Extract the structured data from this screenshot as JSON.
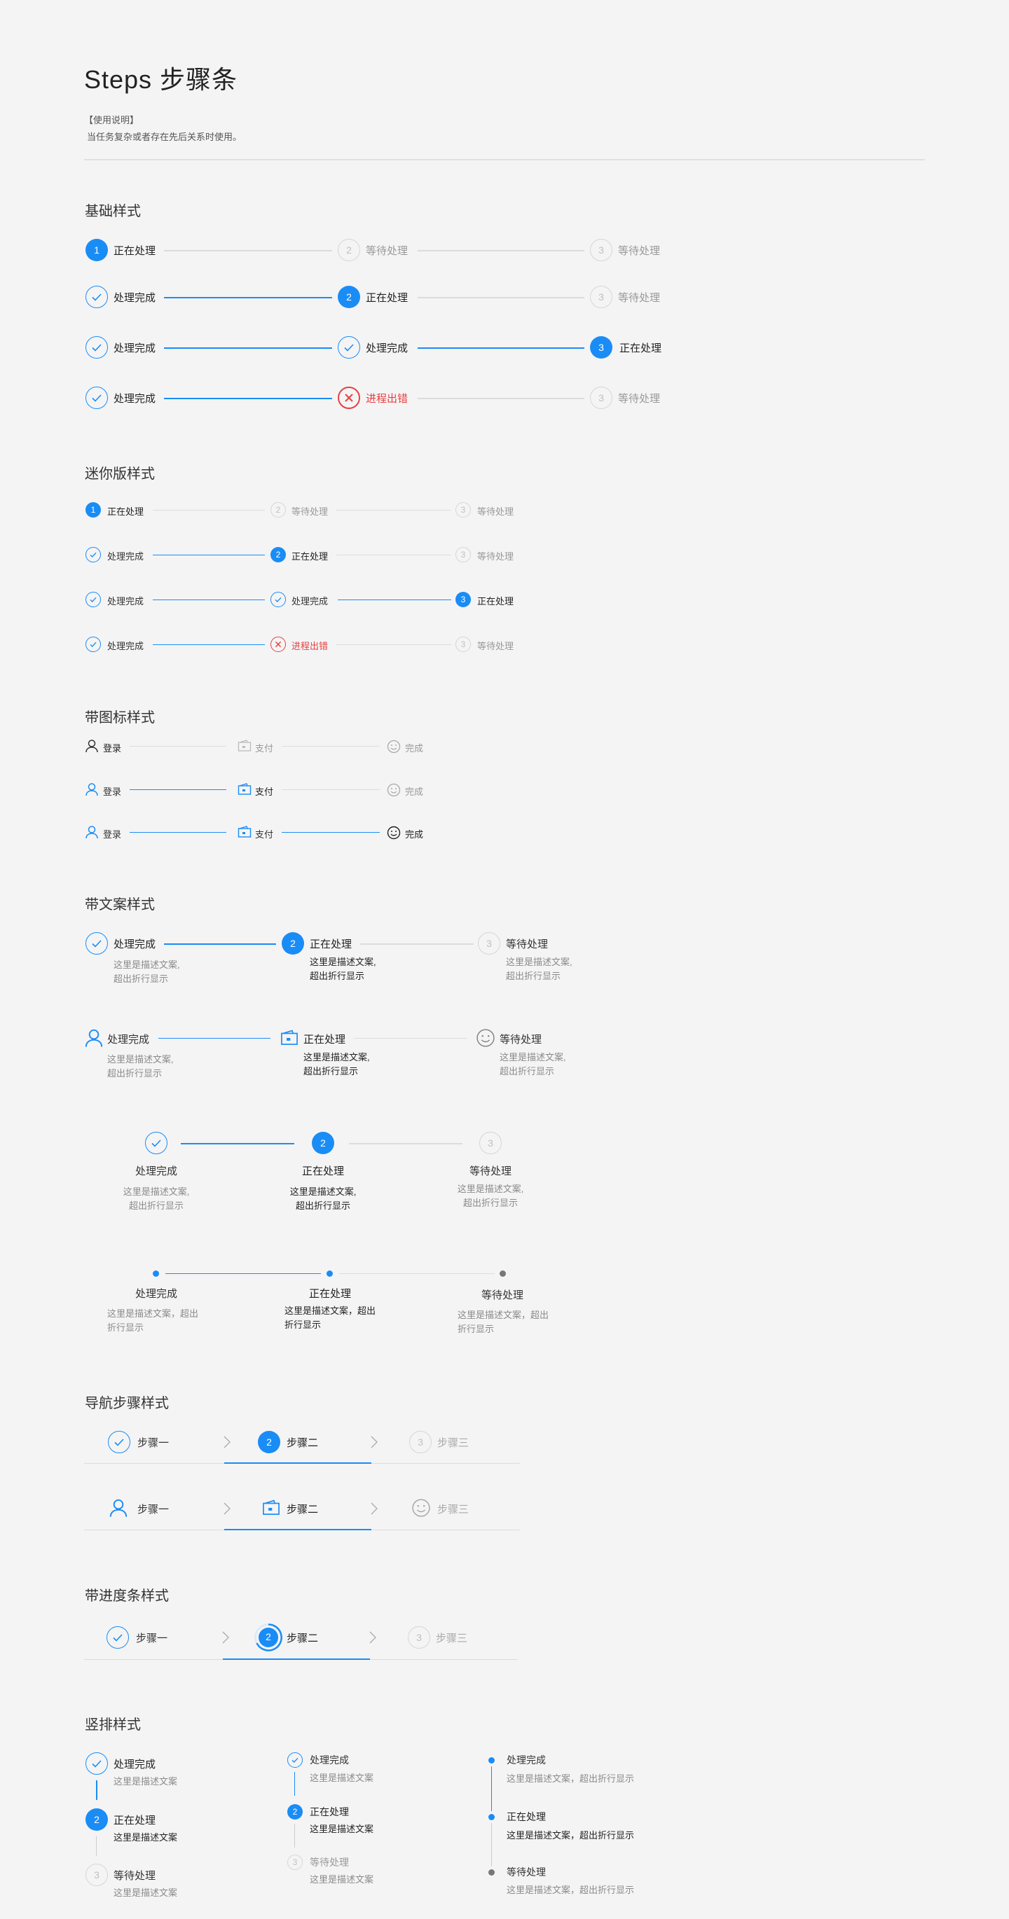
{
  "page": {
    "title": "Steps 步骤条",
    "note_title": "【使用说明】",
    "note_text": "当任务复杂或者存在先后关系时使用。"
  },
  "sections": {
    "basic": "基础样式",
    "mini": "迷你版样式",
    "icon": "带图标样式",
    "desc": "带文案样式",
    "nav": "导航步骤样式",
    "progress": "带进度条样式",
    "vertical": "竖排样式"
  },
  "labels": {
    "processing": "正在处理",
    "waiting": "等待处理",
    "done": "处理完成",
    "error": "进程出错",
    "login": "登录",
    "pay": "支付",
    "finish": "完成",
    "step1": "步骤一",
    "step2": "步骤二",
    "step3": "步骤三"
  },
  "numbers": {
    "n1": "1",
    "n2": "2",
    "n3": "3"
  },
  "descriptions": {
    "line1": "这里是描述文案,",
    "line2": "超出折行显示",
    "wide1": "这里是描述文案，超出",
    "wide2": "折行显示",
    "short": "这里是描述文案",
    "long": "这里是描述文案，超出折行显示"
  },
  "colors": {
    "primary": "#1a8cf5",
    "error": "#e74040",
    "wait": "#c0c0c0",
    "background": "#f4f4f5"
  }
}
